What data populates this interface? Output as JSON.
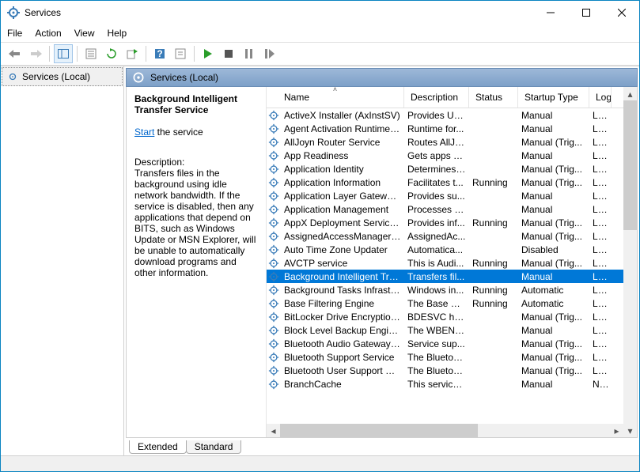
{
  "title": "Services",
  "menu": {
    "file": "File",
    "action": "Action",
    "view": "View",
    "help": "Help"
  },
  "left": {
    "label": "Services (Local)"
  },
  "header": {
    "label": "Services (Local)"
  },
  "detail": {
    "name": "Background Intelligent Transfer Service",
    "start_link": "Start",
    "start_suffix": " the service",
    "desc_label": "Description:",
    "description": "Transfers files in the background using idle network bandwidth. If the service is disabled, then any applications that depend on BITS, such as Windows Update or MSN Explorer, will be unable to automatically download programs and other information."
  },
  "columns": {
    "name": "Name",
    "description": "Description",
    "status": "Status",
    "startup": "Startup Type",
    "logon": "Log"
  },
  "services": [
    {
      "name": "ActiveX Installer (AxInstSV)",
      "desc": "Provides Us...",
      "status": "",
      "startup": "Manual",
      "logon": "Loca"
    },
    {
      "name": "Agent Activation Runtime_...",
      "desc": "Runtime for...",
      "status": "",
      "startup": "Manual",
      "logon": "Loca"
    },
    {
      "name": "AllJoyn Router Service",
      "desc": "Routes AllJo...",
      "status": "",
      "startup": "Manual (Trig...",
      "logon": "Loca"
    },
    {
      "name": "App Readiness",
      "desc": "Gets apps re...",
      "status": "",
      "startup": "Manual",
      "logon": "Loca"
    },
    {
      "name": "Application Identity",
      "desc": "Determines ...",
      "status": "",
      "startup": "Manual (Trig...",
      "logon": "Loca"
    },
    {
      "name": "Application Information",
      "desc": "Facilitates t...",
      "status": "Running",
      "startup": "Manual (Trig...",
      "logon": "Loca"
    },
    {
      "name": "Application Layer Gateway ...",
      "desc": "Provides su...",
      "status": "",
      "startup": "Manual",
      "logon": "Loca"
    },
    {
      "name": "Application Management",
      "desc": "Processes in...",
      "status": "",
      "startup": "Manual",
      "logon": "Loca"
    },
    {
      "name": "AppX Deployment Service (...",
      "desc": "Provides inf...",
      "status": "Running",
      "startup": "Manual (Trig...",
      "logon": "Loca"
    },
    {
      "name": "AssignedAccessManager Se...",
      "desc": "AssignedAc...",
      "status": "",
      "startup": "Manual (Trig...",
      "logon": "Loca"
    },
    {
      "name": "Auto Time Zone Updater",
      "desc": "Automatica...",
      "status": "",
      "startup": "Disabled",
      "logon": "Loca"
    },
    {
      "name": "AVCTP service",
      "desc": "This is Audi...",
      "status": "Running",
      "startup": "Manual (Trig...",
      "logon": "Loca"
    },
    {
      "name": "Background Intelligent Tran...",
      "desc": "Transfers fil...",
      "status": "",
      "startup": "Manual",
      "logon": "Loca",
      "selected": true
    },
    {
      "name": "Background Tasks Infrastruc...",
      "desc": "Windows in...",
      "status": "Running",
      "startup": "Automatic",
      "logon": "Loca"
    },
    {
      "name": "Base Filtering Engine",
      "desc": "The Base Fil...",
      "status": "Running",
      "startup": "Automatic",
      "logon": "Loca"
    },
    {
      "name": "BitLocker Drive Encryption ...",
      "desc": "BDESVC hos...",
      "status": "",
      "startup": "Manual (Trig...",
      "logon": "Loca"
    },
    {
      "name": "Block Level Backup Engine ...",
      "desc": "The WBENG...",
      "status": "",
      "startup": "Manual",
      "logon": "Loca"
    },
    {
      "name": "Bluetooth Audio Gateway S...",
      "desc": "Service sup...",
      "status": "",
      "startup": "Manual (Trig...",
      "logon": "Loca"
    },
    {
      "name": "Bluetooth Support Service",
      "desc": "The Bluetoo...",
      "status": "",
      "startup": "Manual (Trig...",
      "logon": "Loca"
    },
    {
      "name": "Bluetooth User Support Ser...",
      "desc": "The Bluetoo...",
      "status": "",
      "startup": "Manual (Trig...",
      "logon": "Loca"
    },
    {
      "name": "BranchCache",
      "desc": "This service ...",
      "status": "",
      "startup": "Manual",
      "logon": "Netv"
    }
  ],
  "tabs": {
    "extended": "Extended",
    "standard": "Standard"
  }
}
